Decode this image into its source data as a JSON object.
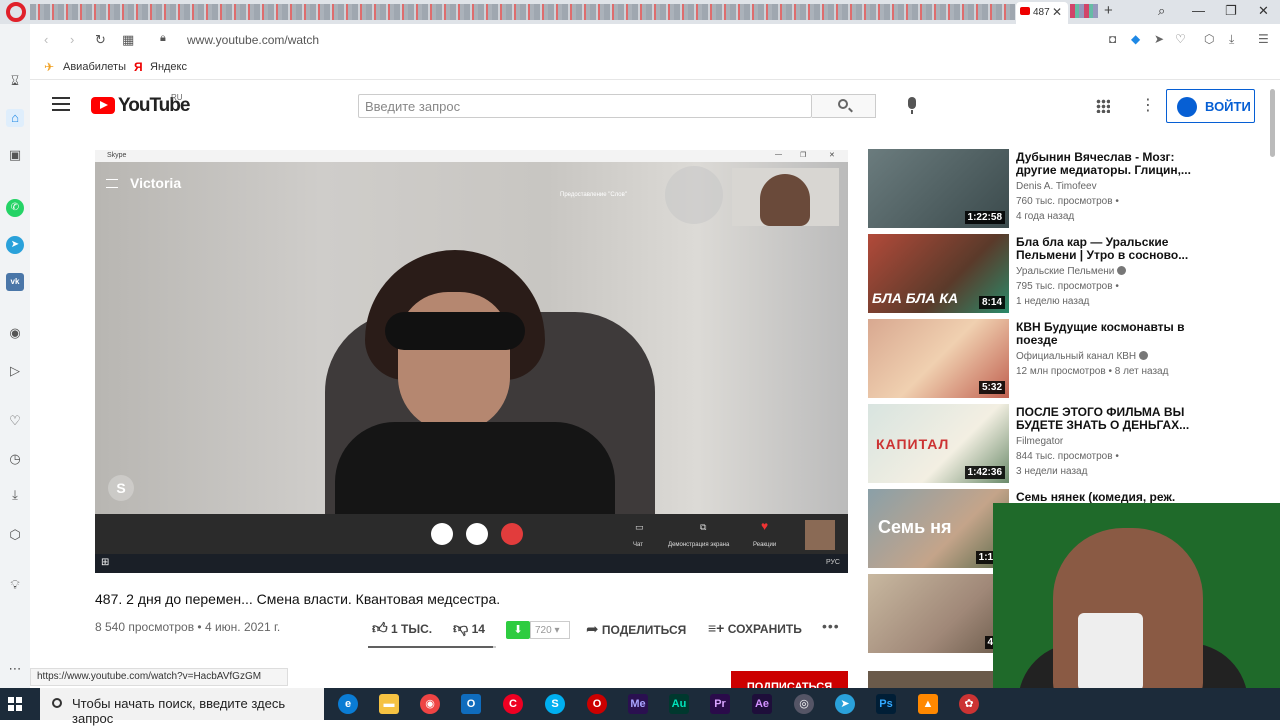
{
  "browser": {
    "active_tab_label": "487",
    "url": "www.youtube.com/watch",
    "bookmarks": [
      "Авиабилеты",
      "Яндекс"
    ],
    "status_url": "https://www.youtube.com/watch?v=HacbAVfGzGM"
  },
  "youtube": {
    "logo_text": "YouTube",
    "region": "RU",
    "search_placeholder": "Введите запрос",
    "signin_label": "ВОЙТИ"
  },
  "player": {
    "skype_window_title": "Skype",
    "caller_name": "Victoria",
    "share_label": "Предоставление \"Слов\"",
    "chat_label": "Чат",
    "screen_share_label": "Демонстрация экрана",
    "reactions_label": "Реакции",
    "tray_text": "РУС"
  },
  "video": {
    "title": "487. 2 дня до перемен... Смена власти. Квантовая медсестра.",
    "views_date": "8 540 просмотров • 4 июн. 2021 г.",
    "likes": "1 ТЫС.",
    "dislikes": "14",
    "quality": "720",
    "share_label": "ПОДЕЛИТЬСЯ",
    "save_label": "СОХРАНИТЬ",
    "like_ratio": 0.98,
    "subscribe_label": "ПОДПИСАТЬСЯ"
  },
  "recommendations": [
    {
      "title": "Дубынин Вячеслав - Мозг: другие медиаторы. Глицин,...",
      "channel": "Denis A. Timofeev",
      "verified": false,
      "views": "760 тыс. просмотров •",
      "age": "4 года назад",
      "duration": "1:22:58"
    },
    {
      "title": "Бла бла кар — Уральские Пельмени | Утро в сосново...",
      "channel": "Уральские Пельмени",
      "verified": true,
      "views": "795 тыс. просмотров •",
      "age": "1 неделю назад",
      "duration": "8:14"
    },
    {
      "title": "КВН Будущие космонавты в поезде",
      "channel": "Официальный канал КВН",
      "verified": true,
      "views": "12 млн просмотров • 8 лет назад",
      "age": "",
      "duration": "5:32"
    },
    {
      "title": "ПОСЛЕ ЭТОГО ФИЛЬМА ВЫ БУДЕТЕ ЗНАТЬ О ДЕНЬГАХ...",
      "channel": "Filmegator",
      "verified": false,
      "views": "844 тыс. просмотров •",
      "age": "3 недели назад",
      "duration": "1:42:36"
    },
    {
      "title": "Семь нянек (комедия, реж.",
      "channel": "",
      "verified": false,
      "views": "",
      "age": "",
      "duration": "1:12:"
    },
    {
      "title": "",
      "channel": "",
      "verified": false,
      "views": "",
      "age": "",
      "duration": "44:"
    }
  ],
  "thumb_texts": {
    "rec2": "БЛА БЛА КА",
    "rec4": "КАПИТАЛ",
    "rec5": "Семь ня"
  },
  "taskbar": {
    "search_placeholder": "Чтобы начать поиск, введите здесь запрос",
    "apps": [
      "Me",
      "Au",
      "Pr",
      "Ae",
      "Ps"
    ]
  },
  "colors": {
    "youtube_red": "#ff0000",
    "signin_blue": "#065fd4",
    "subscribe_red": "#cc0000",
    "taskbar_bg": "#1c2b3a",
    "opera_red": "#e0202a"
  },
  "icons": [
    "opera-logo",
    "search-icon",
    "mic-icon",
    "apps-grid-icon",
    "more-vert-icon",
    "user-avatar-icon",
    "thumbs-up-icon",
    "thumbs-down-icon",
    "share-icon",
    "playlist-add-icon",
    "windows-start-icon"
  ]
}
